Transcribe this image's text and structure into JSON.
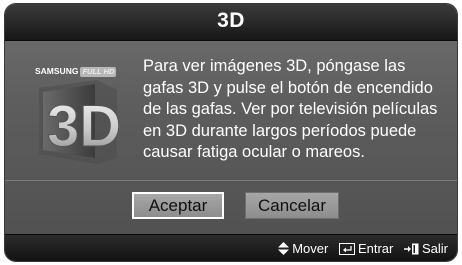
{
  "dialog": {
    "title": "3D",
    "logo": {
      "brand": "SAMSUNG",
      "badge": "FULL HD",
      "mark": "3D",
      "icon": "samsung-3d-logo"
    },
    "message_lines": [
      "Para ver imágenes 3D, póngase las",
      "gafas 3D y pulse el botón de encendido",
      "de las gafas. Ver por televisión películas",
      "en 3D durante largos períodos puede",
      "causar fatiga ocular o mareos."
    ],
    "buttons": {
      "accept": "Aceptar",
      "cancel": "Cancelar",
      "focused": "accept"
    }
  },
  "footer": {
    "move": {
      "icon": "up-down-arrows-icon",
      "label": "Mover"
    },
    "enter": {
      "icon": "enter-icon",
      "label": "Entrar"
    },
    "exit": {
      "icon": "exit-icon",
      "label": "Salir"
    }
  },
  "colors": {
    "panel": "#5d5d5d",
    "titlebar": "#222222",
    "button": "#9a9a9a",
    "text": "#ffffff"
  }
}
